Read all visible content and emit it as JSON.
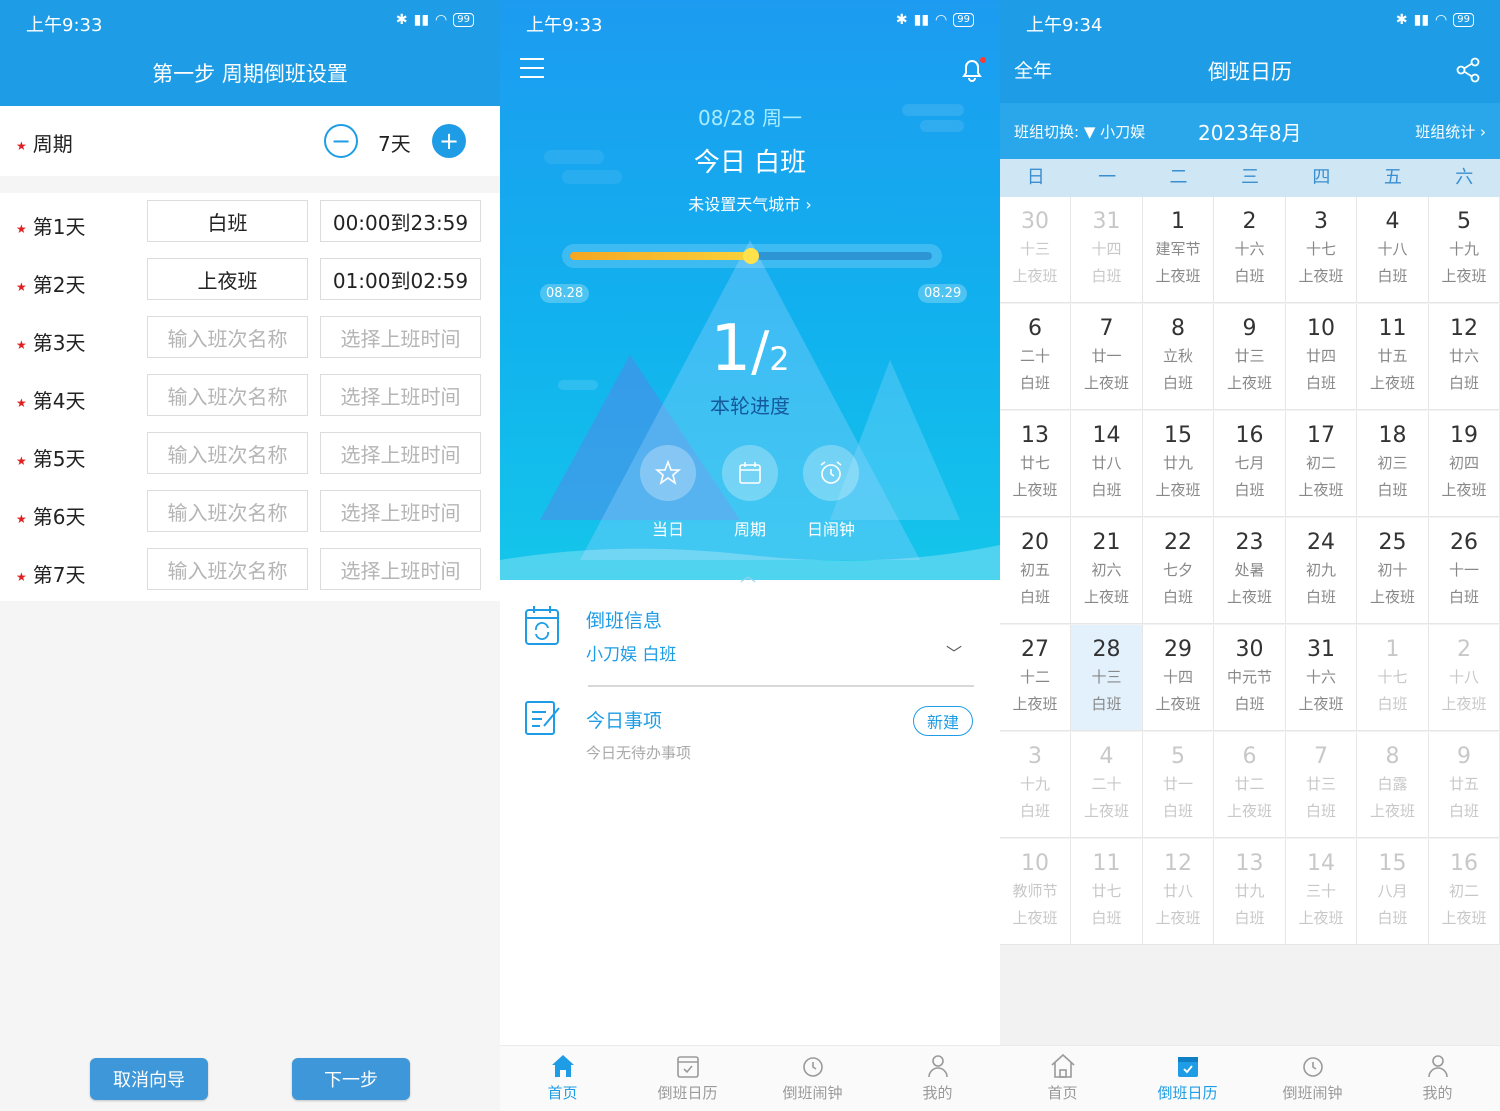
{
  "colors": {
    "accent": "#1e9de6",
    "required_star": "#e02020",
    "highlight_today": "#e3f1fc"
  },
  "status_bar": [
    {
      "time": "上午9:33",
      "battery": "99"
    },
    {
      "time": "上午9:33",
      "battery": "99"
    },
    {
      "time": "上午9:34",
      "battery": "99"
    }
  ],
  "setup": {
    "title": "第一步 周期倒班设置",
    "cycle_label": "周期",
    "cycle_value": "7天",
    "days": [
      {
        "label": "第1天",
        "name": "白班",
        "time": "00:00到23:59",
        "filled": true
      },
      {
        "label": "第2天",
        "name": "上夜班",
        "time": "01:00到02:59",
        "filled": true
      },
      {
        "label": "第3天",
        "name": "输入班次名称",
        "time": "选择上班时间",
        "filled": false
      },
      {
        "label": "第4天",
        "name": "输入班次名称",
        "time": "选择上班时间",
        "filled": false
      },
      {
        "label": "第5天",
        "name": "输入班次名称",
        "time": "选择上班时间",
        "filled": false
      },
      {
        "label": "第6天",
        "name": "输入班次名称",
        "time": "选择上班时间",
        "filled": false
      },
      {
        "label": "第7天",
        "name": "输入班次名称",
        "time": "选择上班时间",
        "filled": false
      }
    ],
    "cancel_label": "取消向导",
    "next_label": "下一步"
  },
  "home": {
    "date": "08/28  周一",
    "today": "今日 白班",
    "weather": "未设置天气城市 ›",
    "progress_start": "08.28",
    "progress_end": "08.29",
    "progress_fraction": 0.5,
    "progress_num": "1",
    "progress_den": "2",
    "progress_label": "本轮进度",
    "quick": [
      {
        "label": "当日",
        "icon": "star-icon"
      },
      {
        "label": "周期",
        "icon": "calendar-icon"
      },
      {
        "label": "日闹钟",
        "icon": "alarm-icon"
      }
    ],
    "info_title": "倒班信息",
    "info_sub": "小刀娱 白班",
    "todo_title": "今日事项",
    "todo_sub": "今日无待办事项",
    "new_label": "新建"
  },
  "nav": [
    {
      "label": "首页",
      "icon": "home-icon"
    },
    {
      "label": "倒班日历",
      "icon": "calendar-icon"
    },
    {
      "label": "倒班闹钟",
      "icon": "alarm-icon"
    },
    {
      "label": "我的",
      "icon": "user-icon"
    }
  ],
  "calendar": {
    "year_label": "全年",
    "title": "倒班日历",
    "group_switch": "班组切换: ▼ 小刀娱",
    "month": "2023年8月",
    "group_stats": "班组统计 ›",
    "weekdays": [
      "日",
      "一",
      "二",
      "三",
      "四",
      "五",
      "六"
    ],
    "cells": [
      {
        "d": "30",
        "l": "十三",
        "s": "上夜班",
        "out": true
      },
      {
        "d": "31",
        "l": "十四",
        "s": "白班",
        "out": true
      },
      {
        "d": "1",
        "l": "建军节",
        "s": "上夜班"
      },
      {
        "d": "2",
        "l": "十六",
        "s": "白班"
      },
      {
        "d": "3",
        "l": "十七",
        "s": "上夜班"
      },
      {
        "d": "4",
        "l": "十八",
        "s": "白班"
      },
      {
        "d": "5",
        "l": "十九",
        "s": "上夜班"
      },
      {
        "d": "6",
        "l": "二十",
        "s": "白班"
      },
      {
        "d": "7",
        "l": "廿一",
        "s": "上夜班"
      },
      {
        "d": "8",
        "l": "立秋",
        "s": "白班"
      },
      {
        "d": "9",
        "l": "廿三",
        "s": "上夜班"
      },
      {
        "d": "10",
        "l": "廿四",
        "s": "白班"
      },
      {
        "d": "11",
        "l": "廿五",
        "s": "上夜班"
      },
      {
        "d": "12",
        "l": "廿六",
        "s": "白班"
      },
      {
        "d": "13",
        "l": "廿七",
        "s": "上夜班"
      },
      {
        "d": "14",
        "l": "廿八",
        "s": "白班"
      },
      {
        "d": "15",
        "l": "廿九",
        "s": "上夜班"
      },
      {
        "d": "16",
        "l": "七月",
        "s": "白班"
      },
      {
        "d": "17",
        "l": "初二",
        "s": "上夜班"
      },
      {
        "d": "18",
        "l": "初三",
        "s": "白班"
      },
      {
        "d": "19",
        "l": "初四",
        "s": "上夜班"
      },
      {
        "d": "20",
        "l": "初五",
        "s": "白班"
      },
      {
        "d": "21",
        "l": "初六",
        "s": "上夜班"
      },
      {
        "d": "22",
        "l": "七夕",
        "s": "白班"
      },
      {
        "d": "23",
        "l": "处暑",
        "s": "上夜班"
      },
      {
        "d": "24",
        "l": "初九",
        "s": "白班"
      },
      {
        "d": "25",
        "l": "初十",
        "s": "上夜班"
      },
      {
        "d": "26",
        "l": "十一",
        "s": "白班"
      },
      {
        "d": "27",
        "l": "十二",
        "s": "上夜班"
      },
      {
        "d": "28",
        "l": "十三",
        "s": "白班",
        "today": true
      },
      {
        "d": "29",
        "l": "十四",
        "s": "上夜班"
      },
      {
        "d": "30",
        "l": "中元节",
        "s": "白班"
      },
      {
        "d": "31",
        "l": "十六",
        "s": "上夜班"
      },
      {
        "d": "1",
        "l": "十七",
        "s": "白班",
        "out": true
      },
      {
        "d": "2",
        "l": "十八",
        "s": "上夜班",
        "out": true
      },
      {
        "d": "3",
        "l": "十九",
        "s": "白班",
        "out": true
      },
      {
        "d": "4",
        "l": "二十",
        "s": "上夜班",
        "out": true
      },
      {
        "d": "5",
        "l": "廿一",
        "s": "白班",
        "out": true
      },
      {
        "d": "6",
        "l": "廿二",
        "s": "上夜班",
        "out": true
      },
      {
        "d": "7",
        "l": "廿三",
        "s": "白班",
        "out": true
      },
      {
        "d": "8",
        "l": "白露",
        "s": "上夜班",
        "out": true
      },
      {
        "d": "9",
        "l": "廿五",
        "s": "白班",
        "out": true
      },
      {
        "d": "10",
        "l": "教师节",
        "s": "上夜班",
        "out": true
      },
      {
        "d": "11",
        "l": "廿七",
        "s": "白班",
        "out": true
      },
      {
        "d": "12",
        "l": "廿八",
        "s": "上夜班",
        "out": true
      },
      {
        "d": "13",
        "l": "廿九",
        "s": "白班",
        "out": true
      },
      {
        "d": "14",
        "l": "三十",
        "s": "上夜班",
        "out": true
      },
      {
        "d": "15",
        "l": "八月",
        "s": "白班",
        "out": true
      },
      {
        "d": "16",
        "l": "初二",
        "s": "上夜班",
        "out": true
      }
    ]
  }
}
